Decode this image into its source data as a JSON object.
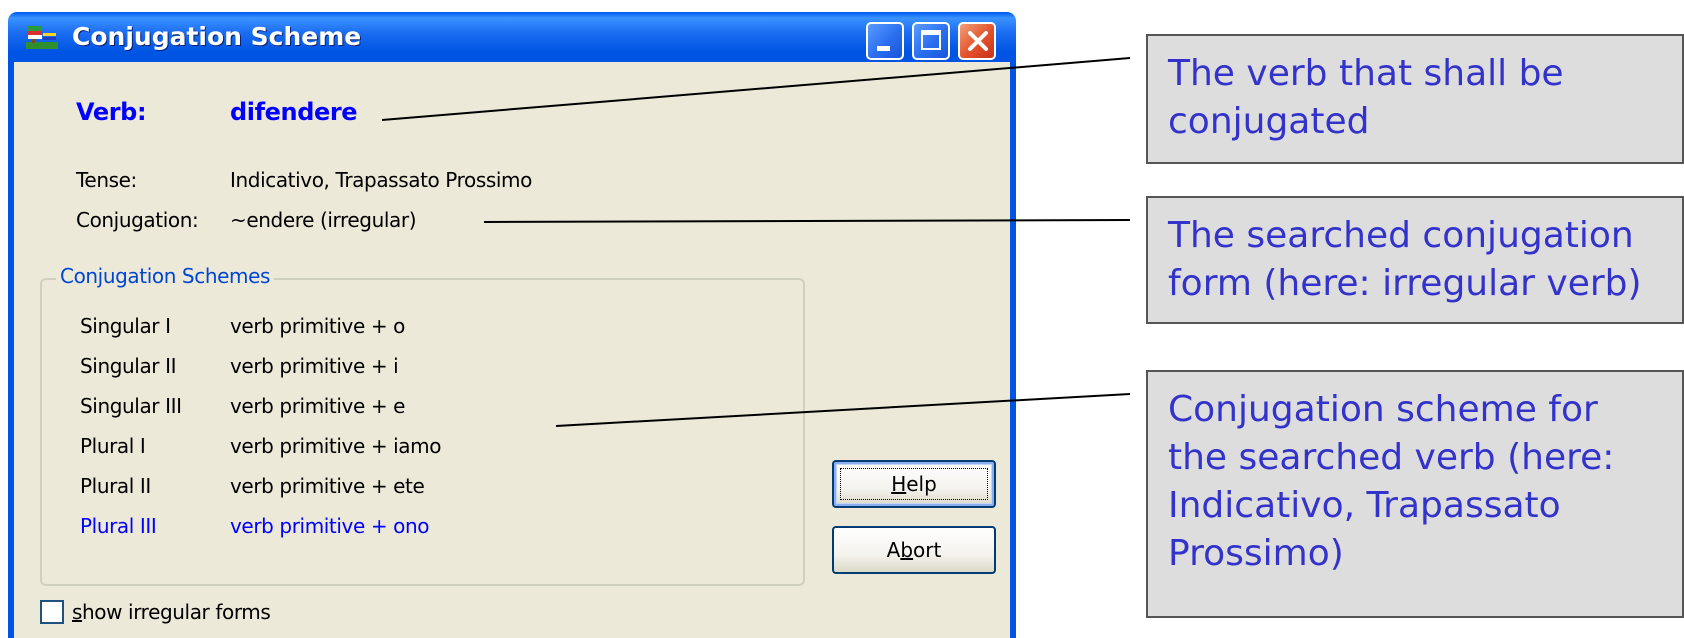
{
  "window": {
    "title": "Conjugation Scheme"
  },
  "verb": {
    "label": "Verb:",
    "value": "difendere"
  },
  "tense": {
    "label": "Tense:",
    "value": "Indicativo, Trapassato Prossimo"
  },
  "conjugation": {
    "label": "Conjugation:",
    "value": "~endere (irregular)"
  },
  "schemes": {
    "legend": "Conjugation Schemes",
    "rows": [
      {
        "person": "Singular I",
        "form": "verb primitive + o"
      },
      {
        "person": "Singular II",
        "form": "verb primitive + i"
      },
      {
        "person": "Singular III",
        "form": "verb primitive + e"
      },
      {
        "person": "Plural I",
        "form": "verb primitive + iamo"
      },
      {
        "person": "Plural II",
        "form": "verb primitive + ete"
      },
      {
        "person": "Plural III",
        "form": "verb primitive + ono"
      }
    ],
    "highlighted_row_color": "#0000ff"
  },
  "buttons": {
    "help": {
      "prefix": "",
      "accel": "H",
      "suffix": "elp"
    },
    "abort": {
      "prefix": "A",
      "accel": "b",
      "suffix": "ort"
    }
  },
  "checkbox": {
    "accel": "s",
    "label_rest": "how irregular forms",
    "checked": false
  },
  "callouts": [
    {
      "text": "The verb that shall be conjugated"
    },
    {
      "text": "The searched conjugation form (here: irregular verb)"
    },
    {
      "text": "Conjugation scheme for the searched verb (here: Indicativo, Trapassato Prossimo)"
    }
  ],
  "colors": {
    "titlebar": "#0054e3",
    "client": "#ece9d8",
    "callout_text": "#3333cc",
    "callout_bg": "#dddddd",
    "accent_blue": "#0000ff"
  }
}
